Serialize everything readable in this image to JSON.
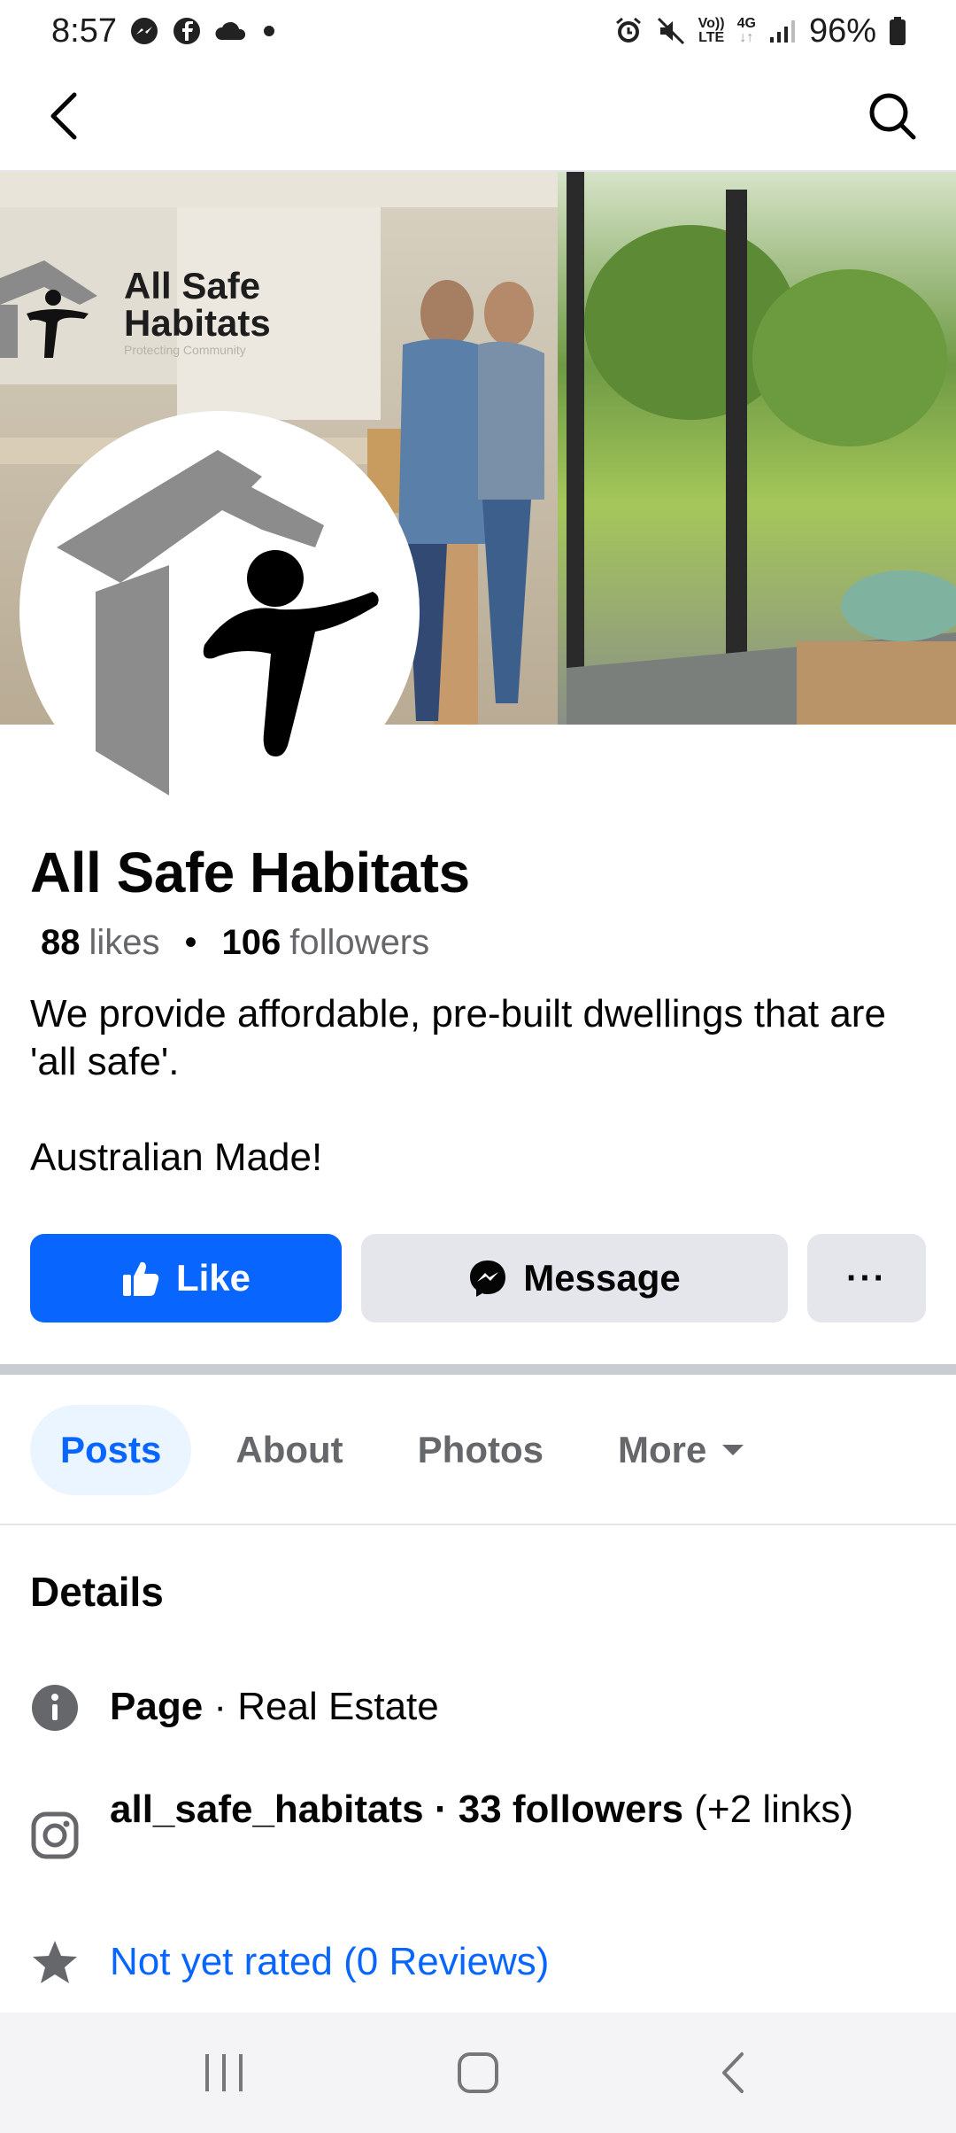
{
  "status_bar": {
    "time": "8:57",
    "battery": "96%",
    "volte_top": "Vo))",
    "volte_bottom": "LTE",
    "network": "4G",
    "left_icons": [
      "messenger-icon",
      "facebook-icon",
      "cloud-icon",
      "dot-icon"
    ],
    "right_icons": [
      "alarm-icon",
      "mute-icon",
      "signal-icon",
      "battery-icon"
    ]
  },
  "nav": {
    "back_icon": "back-arrow-icon",
    "search_icon": "search-icon"
  },
  "cover": {
    "logo_line1": "All Safe",
    "logo_line2": "Habitats",
    "logo_tagline": "Protecting Community"
  },
  "page": {
    "name": "All Safe Habitats",
    "likes_count": "88",
    "likes_label": "likes",
    "separator": "•",
    "followers_count": "106",
    "followers_label": "followers",
    "bio_line1": "We provide affordable, pre-built dwellings that are 'all safe'.",
    "bio_line2": "Australian Made!"
  },
  "actions": {
    "like_label": "Like",
    "message_label": "Message",
    "more_label": "···"
  },
  "tabs": [
    {
      "label": "Posts",
      "active": true
    },
    {
      "label": "About",
      "active": false
    },
    {
      "label": "Photos",
      "active": false
    },
    {
      "label": "More",
      "active": false
    }
  ],
  "details": {
    "title": "Details",
    "page_type_bold": "Page",
    "page_type_rest": " · Real Estate",
    "instagram_bold": "all_safe_habitats · 33 followers",
    "instagram_rest": " (+2 links)",
    "rating": "Not yet rated (0 Reviews)"
  },
  "colors": {
    "accent": "#0866ff",
    "button_gray": "#e4e6eb",
    "secondary_text": "#65676b"
  }
}
